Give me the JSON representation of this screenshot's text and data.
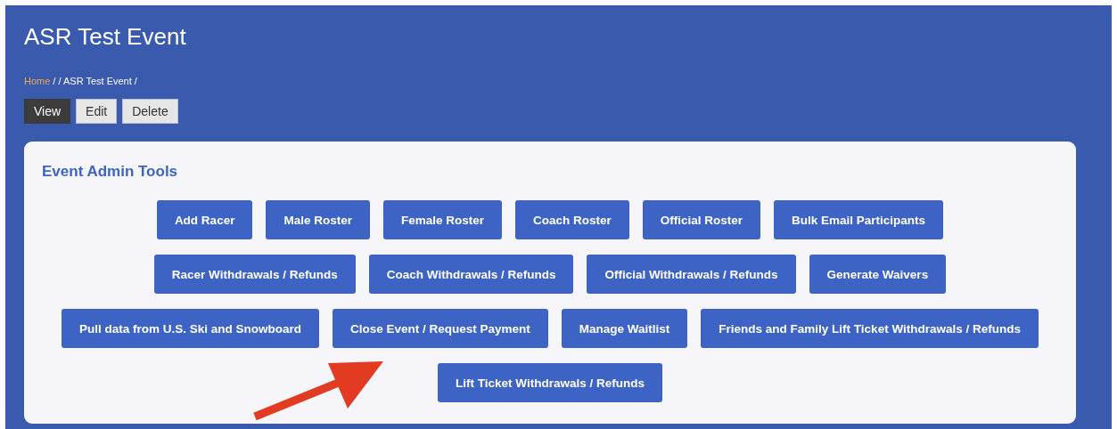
{
  "title": "ASR Test Event",
  "breadcrumb": [
    {
      "label": "Home",
      "kind": "link"
    },
    {
      "label": "/ / ASR Test Event /",
      "kind": "text"
    }
  ],
  "tabs": [
    {
      "label": "View",
      "selected": true
    },
    {
      "label": "Edit",
      "selected": false
    },
    {
      "label": "Delete",
      "selected": false
    }
  ],
  "panel": {
    "title": "Event Admin Tools",
    "button_rows": [
      [
        "Add Racer",
        "Male Roster",
        "Female Roster",
        "Coach Roster",
        "Official Roster",
        "Bulk Email Participants"
      ],
      [
        "Racer Withdrawals / Refunds",
        "Coach Withdrawals / Refunds",
        "Official Withdrawals / Refunds",
        "Generate Waivers"
      ],
      [
        "Pull data from U.S. Ski and Snowboard",
        "Close Event / Request Payment",
        "Manage Waitlist",
        "Friends and Family Lift Ticket Withdrawals / Refunds"
      ],
      [
        "Lift Ticket Withdrawals / Refunds"
      ]
    ]
  },
  "annotations": [
    {
      "kind": "arrow"
    }
  ]
}
